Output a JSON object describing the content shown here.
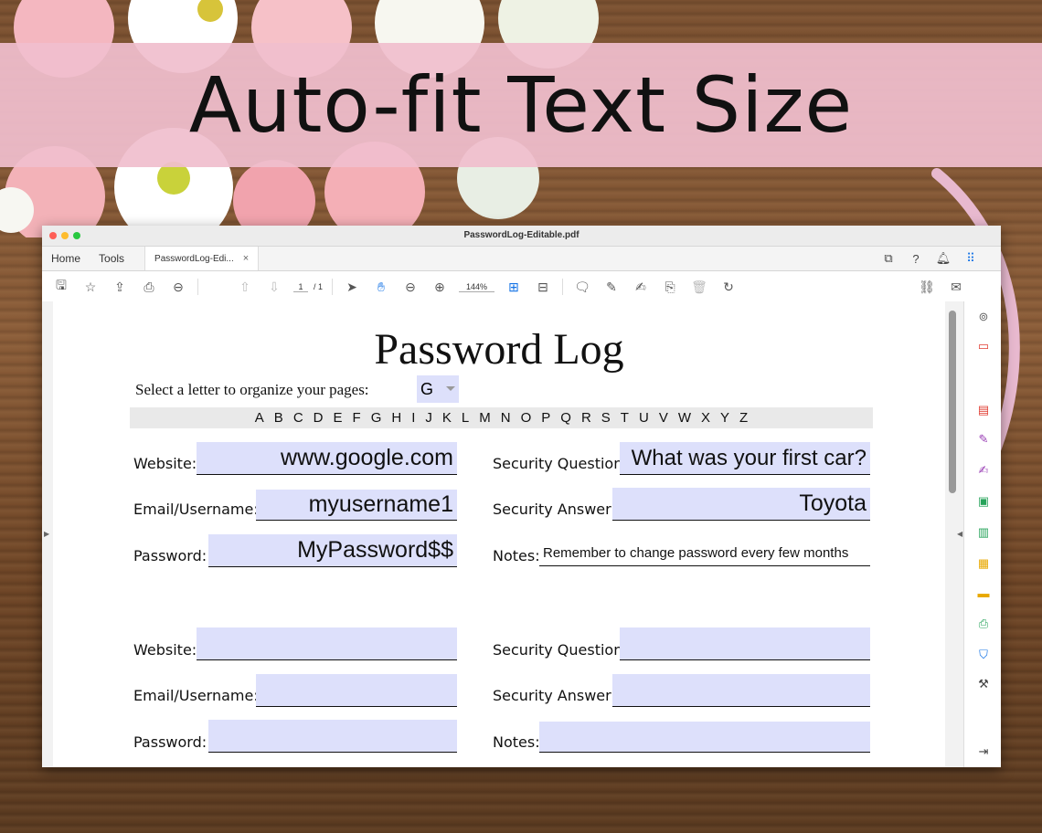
{
  "banner": {
    "title": "Auto-fit Text Size"
  },
  "window": {
    "title": "PasswordLog-Editable.pdf"
  },
  "tabs": {
    "home": "Home",
    "tools": "Tools",
    "doc": "PasswordLog-Edi...",
    "close": "×"
  },
  "toolbar": {
    "page_current": "1",
    "page_total": "/ 1",
    "zoom": "144%"
  },
  "document": {
    "title": "Password Log",
    "select_label": "Select a letter to organize your pages:",
    "select_value": "G",
    "alphabet": [
      "A",
      "B",
      "C",
      "D",
      "E",
      "F",
      "G",
      "H",
      "I",
      "J",
      "K",
      "L",
      "M",
      "N",
      "O",
      "P",
      "Q",
      "R",
      "S",
      "T",
      "U",
      "V",
      "W",
      "X",
      "Y",
      "Z"
    ],
    "labels": {
      "website": "Website:",
      "email": "Email/Username:",
      "password": "Password:",
      "security_question": "Security Question:",
      "security_answer": "Security Answer:",
      "notes": "Notes:"
    },
    "entry1": {
      "website": "www.google.com",
      "email": "myusername1",
      "password": "MyPassword$$",
      "security_question": "What was your first car?",
      "security_answer": "Toyota",
      "notes": "Remember to change password every few months"
    }
  },
  "colors": {
    "field_fill": "#dde0fb",
    "banner": "#f0bece",
    "accent": "#1473e6"
  },
  "icons": [
    "save-icon",
    "star-icon",
    "upload-icon",
    "print-icon",
    "zoom-out-icon",
    "page-up-icon",
    "page-down-icon",
    "cursor-icon",
    "hand-icon",
    "minus-icon",
    "plus-icon",
    "fit-icon",
    "measure-icon",
    "comment-icon",
    "pen-icon",
    "sign-icon",
    "stamp-icon",
    "trash-icon",
    "rotate-icon"
  ]
}
